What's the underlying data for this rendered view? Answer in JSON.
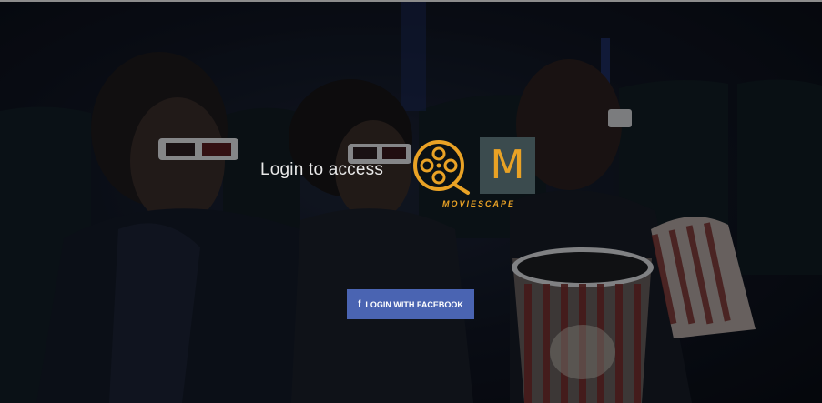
{
  "hero": {
    "tagline": "Login to access",
    "brand_letter": "M",
    "brand_name": "MOVIESCAPE",
    "accent_color": "#e9a225"
  },
  "login": {
    "facebook_icon": "f",
    "facebook_label": "LOGIN WITH FACEBOOK",
    "button_color": "#4a64b2"
  }
}
